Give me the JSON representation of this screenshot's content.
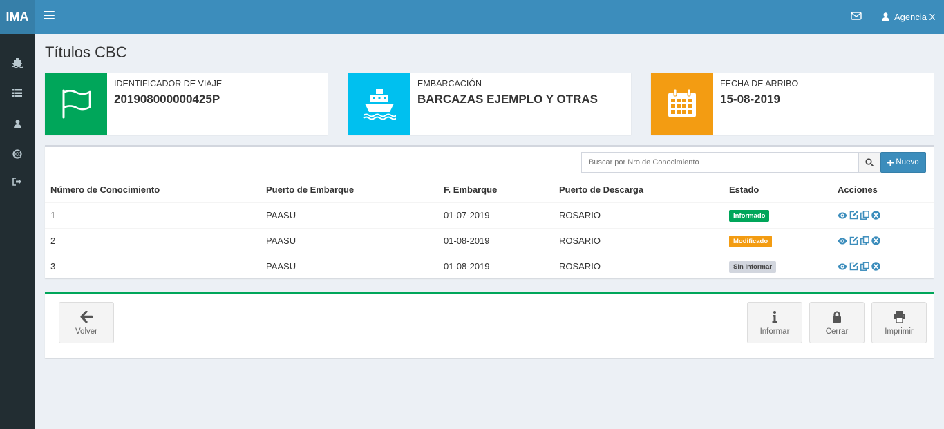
{
  "app": {
    "logo": "IMA",
    "user": "Agencia X"
  },
  "page": {
    "title": "Títulos CBC"
  },
  "info_boxes": [
    {
      "label": "IDENTIFICADOR DE VIAJE",
      "value": "201908000000425P",
      "color": "#00a65a",
      "icon": "flag-icon"
    },
    {
      "label": "EMBARCACIÓN",
      "value": "BARCAZAS EJEMPLO Y OTRAS",
      "color": "#00c0ef",
      "icon": "ship-icon"
    },
    {
      "label": "FECHA DE ARRIBO",
      "value": "15-08-2019",
      "color": "#f39c12",
      "icon": "calendar-icon"
    }
  ],
  "search": {
    "placeholder": "Buscar por Nro de Conocimiento"
  },
  "buttons": {
    "nuevo": "Nuevo",
    "volver": "Volver",
    "informar": "Informar",
    "cerrar": "Cerrar",
    "imprimir": "Imprimir"
  },
  "table": {
    "headers": [
      "Número de Conocimiento",
      "Puerto de Embarque",
      "F. Embarque",
      "Puerto de Descarga",
      "Estado",
      "Acciones"
    ],
    "rows": [
      {
        "numero": "1",
        "puerto_embarque": "PAASU",
        "f_embarque": "01-07-2019",
        "puerto_descarga": "ROSARIO",
        "estado": "Informado",
        "estado_color": "#00a65a",
        "estado_text_color": "#ffffff"
      },
      {
        "numero": "2",
        "puerto_embarque": "PAASU",
        "f_embarque": "01-08-2019",
        "puerto_descarga": "ROSARIO",
        "estado": "Modificado",
        "estado_color": "#f39c12",
        "estado_text_color": "#ffffff"
      },
      {
        "numero": "3",
        "puerto_embarque": "PAASU",
        "f_embarque": "01-08-2019",
        "puerto_descarga": "ROSARIO",
        "estado": "Sin Informar",
        "estado_color": "#d2d6de",
        "estado_text_color": "#444444"
      }
    ]
  },
  "colors": {
    "header": "#3c8dbc",
    "logo_bg": "#367fa9",
    "sidebar": "#222d32",
    "background": "#ecf0f5",
    "action_icons": "#3c8dbc"
  }
}
